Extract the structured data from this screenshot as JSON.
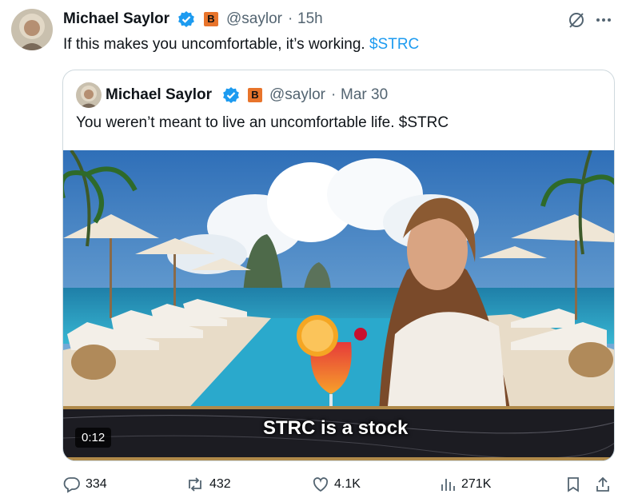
{
  "post": {
    "author_name": "Michael Saylor",
    "author_handle": "@saylor",
    "separator": "·",
    "time": "15h",
    "badge_letter": "B",
    "text_main": "If this makes you uncomfortable, it’s working.",
    "text_tag": "$STRC"
  },
  "quote": {
    "author_name": "Michael Saylor",
    "author_handle": "@saylor",
    "separator": "·",
    "time": "Mar 30",
    "badge_letter": "B",
    "text": "You weren’t meant to live an uncomfortable life. $STRC",
    "video": {
      "duration": "0:12",
      "caption": "STRC is a stock"
    }
  },
  "actions": {
    "replies": "334",
    "reposts": "432",
    "likes": "4.1K",
    "views": "271K"
  },
  "icons": {
    "verified": "verified-badge-icon",
    "grok": "grok-icon",
    "more": "more-icon",
    "reply": "reply-icon",
    "repost": "repost-icon",
    "like": "heart-icon",
    "views": "views-icon",
    "bookmark": "bookmark-icon",
    "share": "share-icon"
  },
  "colors": {
    "accent": "#1d9bf0",
    "muted": "#536471",
    "badge_orange": "#e8742b"
  }
}
